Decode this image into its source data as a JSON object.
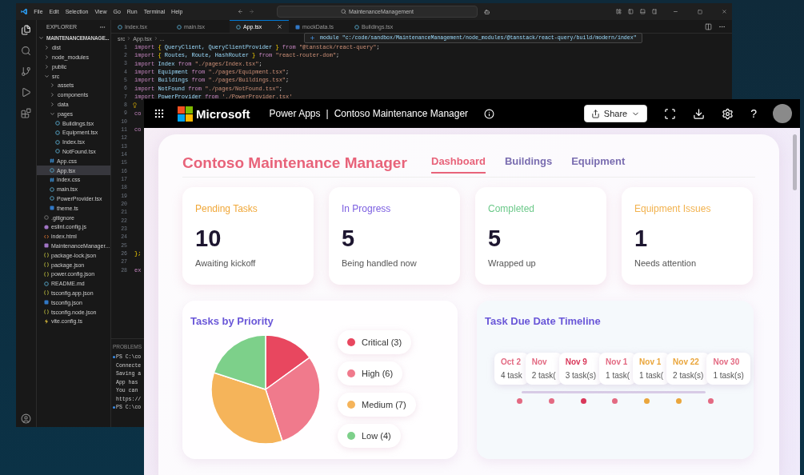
{
  "vscode": {
    "menu": [
      "File",
      "Edit",
      "Selection",
      "View",
      "Go",
      "Run",
      "Terminal",
      "Help"
    ],
    "search": {
      "value": "MaintenanceManagement"
    },
    "explorer": {
      "title": "EXPLORER",
      "tree": [
        {
          "label": "MAINTENANCEMANAGE...",
          "kind": "folder",
          "expanded": true,
          "selected": false,
          "children": [
            {
              "label": "dist",
              "kind": "folder",
              "expanded": false,
              "selected": false
            },
            {
              "label": "node_modules",
              "kind": "folder",
              "expanded": false,
              "selected": false
            },
            {
              "label": "public",
              "kind": "folder",
              "expanded": false,
              "selected": false
            },
            {
              "label": "src",
              "kind": "folder",
              "expanded": true,
              "selected": false,
              "children": [
                {
                  "label": "assets",
                  "kind": "folder",
                  "expanded": false,
                  "selected": false
                },
                {
                  "label": "components",
                  "kind": "folder",
                  "expanded": false,
                  "selected": false
                },
                {
                  "label": "data",
                  "kind": "folder",
                  "expanded": false,
                  "selected": false
                },
                {
                  "label": "pages",
                  "kind": "folder",
                  "expanded": true,
                  "selected": false,
                  "children": [
                    {
                      "label": "Buildings.tsx",
                      "kind": "tsx",
                      "selected": false
                    },
                    {
                      "label": "Equipment.tsx",
                      "kind": "tsx",
                      "selected": false
                    },
                    {
                      "label": "Index.tsx",
                      "kind": "tsx",
                      "selected": false
                    },
                    {
                      "label": "NotFound.tsx",
                      "kind": "tsx",
                      "selected": false
                    }
                  ]
                },
                {
                  "label": "App.css",
                  "kind": "css",
                  "selected": false
                },
                {
                  "label": "App.tsx",
                  "kind": "tsx",
                  "selected": true
                },
                {
                  "label": "index.css",
                  "kind": "css",
                  "selected": false
                },
                {
                  "label": "main.tsx",
                  "kind": "tsx",
                  "selected": false
                },
                {
                  "label": "PowerProvider.tsx",
                  "kind": "tsx",
                  "selected": false
                },
                {
                  "label": "theme.ts",
                  "kind": "ts",
                  "selected": false
                }
              ]
            },
            {
              "label": ".gitignore",
              "kind": "git",
              "selected": false
            },
            {
              "label": "eslint.config.js",
              "kind": "js",
              "selected": false
            },
            {
              "label": "index.html",
              "kind": "html",
              "selected": false
            },
            {
              "label": "MaintenanceManager...",
              "kind": "app",
              "selected": false
            },
            {
              "label": "package-lock.json",
              "kind": "json",
              "selected": false
            },
            {
              "label": "package.json",
              "kind": "json",
              "selected": false
            },
            {
              "label": "power.config.json",
              "kind": "json",
              "selected": false
            },
            {
              "label": "README.md",
              "kind": "md",
              "selected": false
            },
            {
              "label": "tsconfig.app.json",
              "kind": "json",
              "selected": false
            },
            {
              "label": "tsconfig.json",
              "kind": "tsjson",
              "selected": false
            },
            {
              "label": "tsconfig.node.json",
              "kind": "json",
              "selected": false
            },
            {
              "label": "vite.config.ts",
              "kind": "vite",
              "selected": false
            }
          ]
        }
      ]
    },
    "tabs": [
      {
        "label": "Index.tsx",
        "kind": "tsx",
        "selected": false
      },
      {
        "label": "main.tsx",
        "kind": "tsx",
        "selected": false
      },
      {
        "label": "App.tsx",
        "kind": "tsx",
        "selected": true
      },
      {
        "label": "mockData.ts",
        "kind": "ts",
        "selected": false
      },
      {
        "label": "Buildings.tsx",
        "kind": "tsx",
        "selected": false
      }
    ],
    "breadcrumb": [
      "src",
      "App.tsx",
      "..."
    ],
    "hover": "module \"c:/code/sandbox/MaintenanceManagement/node_modules/@tanstack/react-query/build/modern/index\"",
    "lines": [
      {
        "number": "1",
        "code": [
          {
            "text": "import",
            "kind": "kw"
          },
          {
            "text": " { ",
            "kind": "punct"
          },
          {
            "text": "QueryClient, QueryClientProvider",
            "kind": "id"
          },
          {
            "text": " } ",
            "kind": "punct"
          },
          {
            "text": "from ",
            "kind": "kw"
          },
          {
            "text": "\"@tanstack/react-query\"",
            "kind": "str"
          },
          {
            "text": ";",
            "kind": "plain"
          }
        ]
      },
      {
        "number": "2",
        "code": [
          {
            "text": "import",
            "kind": "kw"
          },
          {
            "text": " { ",
            "kind": "punct"
          },
          {
            "text": "Routes, Route, HashRouter",
            "kind": "id"
          },
          {
            "text": " } ",
            "kind": "punct"
          },
          {
            "text": "from ",
            "kind": "kw"
          },
          {
            "text": "\"react-router-dom\"",
            "kind": "str"
          },
          {
            "text": ";",
            "kind": "plain"
          }
        ]
      },
      {
        "number": "3",
        "code": [
          {
            "text": "import ",
            "kind": "kw"
          },
          {
            "text": "Index ",
            "kind": "id"
          },
          {
            "text": "from ",
            "kind": "kw"
          },
          {
            "text": "\"./pages/Index.tsx\"",
            "kind": "str"
          },
          {
            "text": ";",
            "kind": "plain"
          }
        ]
      },
      {
        "number": "4",
        "code": [
          {
            "text": "import ",
            "kind": "kw"
          },
          {
            "text": "Equipment ",
            "kind": "id"
          },
          {
            "text": "from ",
            "kind": "kw"
          },
          {
            "text": "\"./pages/Equipment.tsx\"",
            "kind": "str"
          },
          {
            "text": ";",
            "kind": "plain"
          }
        ]
      },
      {
        "number": "5",
        "code": [
          {
            "text": "import ",
            "kind": "kw"
          },
          {
            "text": "Buildings ",
            "kind": "id"
          },
          {
            "text": "from ",
            "kind": "kw"
          },
          {
            "text": "\"./pages/Buildings.tsx\"",
            "kind": "str"
          },
          {
            "text": ";",
            "kind": "plain"
          }
        ]
      },
      {
        "number": "6",
        "code": [
          {
            "text": "import ",
            "kind": "kw"
          },
          {
            "text": "NotFound ",
            "kind": "id"
          },
          {
            "text": "from ",
            "kind": "kw"
          },
          {
            "text": "\"./pages/NotFound.tsx\"",
            "kind": "str"
          },
          {
            "text": ";",
            "kind": "plain"
          }
        ]
      },
      {
        "number": "7",
        "code": [
          {
            "text": "import ",
            "kind": "kw"
          },
          {
            "text": "PowerProvider ",
            "kind": "id"
          },
          {
            "text": "from ",
            "kind": "kw"
          },
          {
            "text": "'./PowerProvider.tsx'",
            "kind": "str"
          }
        ]
      },
      {
        "number": "8",
        "hint": true
      },
      {
        "number": "9",
        "code": [
          {
            "text": "co",
            "kind": "kw"
          }
        ]
      },
      {
        "number": "10"
      },
      {
        "number": "11",
        "code": [
          {
            "text": "co",
            "kind": "kw"
          }
        ]
      },
      {
        "number": "12"
      },
      {
        "number": "13"
      },
      {
        "number": "14"
      },
      {
        "number": "15"
      },
      {
        "number": "16"
      },
      {
        "number": "17"
      },
      {
        "number": "18"
      },
      {
        "number": "19"
      },
      {
        "number": "20"
      },
      {
        "number": "21"
      },
      {
        "number": "22"
      },
      {
        "number": "23"
      },
      {
        "number": "24"
      },
      {
        "number": "25"
      },
      {
        "number": "26",
        "code": [
          {
            "text": "};",
            "kind": "punct"
          }
        ]
      },
      {
        "number": "27"
      },
      {
        "number": "28",
        "code": [
          {
            "text": "ex",
            "kind": "kw"
          }
        ]
      }
    ],
    "panel": {
      "tab": "PROBLEMS",
      "lines": [
        {
          "text": "PS C:\\co",
          "kind": "prompt"
        },
        {
          "text": "Connecte",
          "kind": "output"
        },
        {
          "text": "Saving a",
          "kind": "output"
        },
        {
          "text": "App has",
          "kind": "output"
        },
        {
          "text": "You can",
          "kind": "output"
        },
        {
          "text": "https://",
          "kind": "output"
        },
        {
          "text": "PS C:\\co",
          "kind": "prompt"
        }
      ]
    }
  },
  "powerapps": {
    "brand": "Microsoft",
    "product": "Power Apps",
    "separator": "|",
    "app_title": "Contoso Maintenance Manager",
    "share": "Share",
    "help": "?",
    "title": "Contoso Maintenance Manager",
    "nav": [
      {
        "label": "Dashboard",
        "selected": true
      },
      {
        "label": "Buildings",
        "selected": false
      },
      {
        "label": "Equipment",
        "selected": false
      }
    ],
    "stats": [
      {
        "label": "Pending Tasks",
        "value": "10",
        "caption": "Awaiting kickoff",
        "color": "#f0a83a"
      },
      {
        "label": "In Progress",
        "value": "5",
        "caption": "Being handled now",
        "color": "#7b5ee0"
      },
      {
        "label": "Completed",
        "value": "5",
        "caption": "Wrapped up",
        "color": "#6cc98a"
      },
      {
        "label": "Equipment Issues",
        "value": "1",
        "caption": "Needs attention",
        "color": "#f2b24e"
      }
    ],
    "priority": {
      "title": "Tasks by Priority",
      "chart_data": {
        "type": "pie",
        "categories": [
          "Critical",
          "High",
          "Medium",
          "Low"
        ],
        "values": [
          15,
          30,
          35,
          20
        ]
      },
      "legend": [
        {
          "count": "(3)",
          "color": "#e8475f"
        },
        {
          "count": "(6)",
          "color": "#f07a8c"
        },
        {
          "count": "(7)",
          "color": "#f5b45a"
        },
        {
          "count": "(4)",
          "color": "#7dd08a"
        }
      ]
    },
    "timeline": {
      "title": "Task Due Date Timeline",
      "items": [
        {
          "date": "Oct 2",
          "count": "4 task",
          "color": "#e36a82"
        },
        {
          "date": "Nov",
          "count": "2 task(",
          "color": "#e36a82"
        },
        {
          "date": "Nov 9",
          "count": "3 task(s)",
          "color": "#d9385a"
        },
        {
          "date": "Nov 1",
          "count": "1 task(",
          "color": "#e36a82"
        },
        {
          "date": "Nov 1",
          "count": "1 task(",
          "color": "#eaa63c"
        },
        {
          "date": "Nov 22",
          "count": "2 task(s)",
          "color": "#eaa63c"
        },
        {
          "date": "Nov 30",
          "count": "1 task(s)",
          "color": "#e36a82"
        }
      ]
    }
  }
}
